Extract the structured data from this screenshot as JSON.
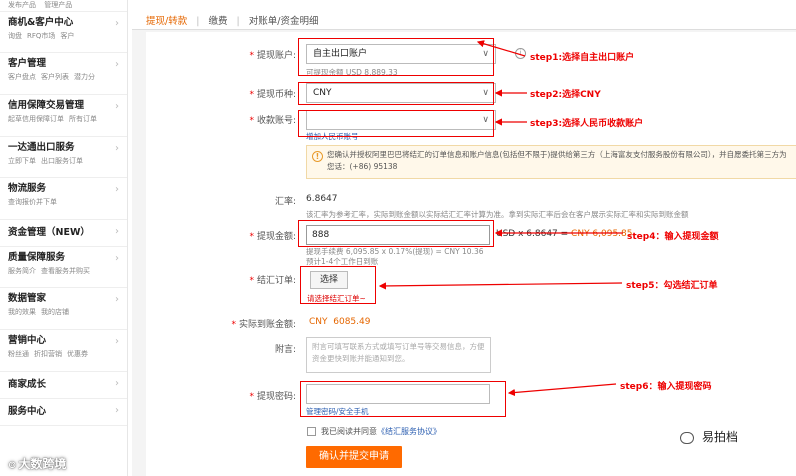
{
  "sidebar": {
    "top_links": [
      "发布产品",
      "管理产品"
    ],
    "sections": [
      {
        "title": "商机&客户中心",
        "subs": [
          "询盘",
          "RFQ市场",
          "客户"
        ]
      },
      {
        "title": "客户管理",
        "subs": [
          "客户盘点",
          "客户列表",
          "潜力分"
        ]
      },
      {
        "title": "信用保障交易管理",
        "subs": [
          "起草信用保障订单",
          "所有订单"
        ]
      },
      {
        "title": "一达通出口服务",
        "subs": [
          "立即下单",
          "出口服务订单"
        ]
      },
      {
        "title": "物流服务",
        "subs": [
          "查询报价并下单"
        ]
      },
      {
        "title": "资金管理（NEW）",
        "subs": []
      },
      {
        "title": "质量保障服务",
        "subs": [
          "服务简介",
          "查看服务并购买"
        ]
      },
      {
        "title": "数据管家",
        "subs": [
          "我的效果",
          "我的店铺"
        ]
      },
      {
        "title": "营销中心",
        "subs": [
          "粉丝通",
          "折扣营销",
          "优惠券"
        ]
      },
      {
        "title": "商家成长",
        "subs": []
      },
      {
        "title": "服务中心",
        "subs": []
      }
    ]
  },
  "tabs": {
    "items": [
      "提现/转款",
      "缴费",
      "对账单/资金明细"
    ],
    "active": 0
  },
  "form": {
    "account_label": "提现账户:",
    "account_value": "自主出口账户",
    "account_hint": "可提现余额 USD 8,889.33",
    "currency_label": "提现币种:",
    "currency_value": "CNY",
    "receive_label": "收款账号:",
    "receive_value": "",
    "receive_hint": "增加人民币账号",
    "notice_text": "您确认并授权阿里巴巴将结汇的订单信息和账户信息(包括但不限于)提供给第三方（上海富友支付服务股份有限公司），并自愿委托第三方为您话：(+86) 95138",
    "rate_label": "汇率:",
    "rate_value": "6.8647",
    "rate_hint": "该汇率为参考汇率，实际到账金额以实际结汇汇率计算为准。拿到实际汇率后会在客户展示实际汇率和实际到账金额",
    "amount_label": "提现金额:",
    "amount_value": "888",
    "amount_calc_prefix": "USD x 6.8647 =",
    "amount_calc_result": "CNY 6,095.85",
    "amount_fee": "提现手续费 6,095.85 x 0.17%(提现) = CNY 10.36",
    "amount_eta": "预计1-4个工作日到账",
    "order_label": "结汇订单:",
    "order_button": "选择",
    "order_error": "请选择结汇订单~",
    "actual_label": "实际到账金额:",
    "actual_currency": "CNY",
    "actual_value": "6085.49",
    "note_label": "附言:",
    "note_placeholder": "附言可填写联系方式或填写订单号等交易信息，方便资金更快到账并能通知到您。",
    "password_label": "提现密码:",
    "password_value": "",
    "password_link": "管理密码/安全手机",
    "agree_text": "我已阅读并同意",
    "agree_link": "《结汇服务协议》",
    "submit_label": "确认并提交申请"
  },
  "annotations": {
    "step1": "step1:选择自主出口账户",
    "step2": "step2:选择CNY",
    "step3": "step3:选择人民币收款账户",
    "step4": "step4：输入提现金额",
    "step5": "step5：勾选结汇订单",
    "step6": "step6：输入提现密码",
    "color": "#e00000"
  },
  "watermarks": {
    "left": "大数跨境",
    "right": "易拍档"
  },
  "colors": {
    "accent": "#ff6a00",
    "tab_active": "#e56600",
    "annotation": "#e00000"
  }
}
